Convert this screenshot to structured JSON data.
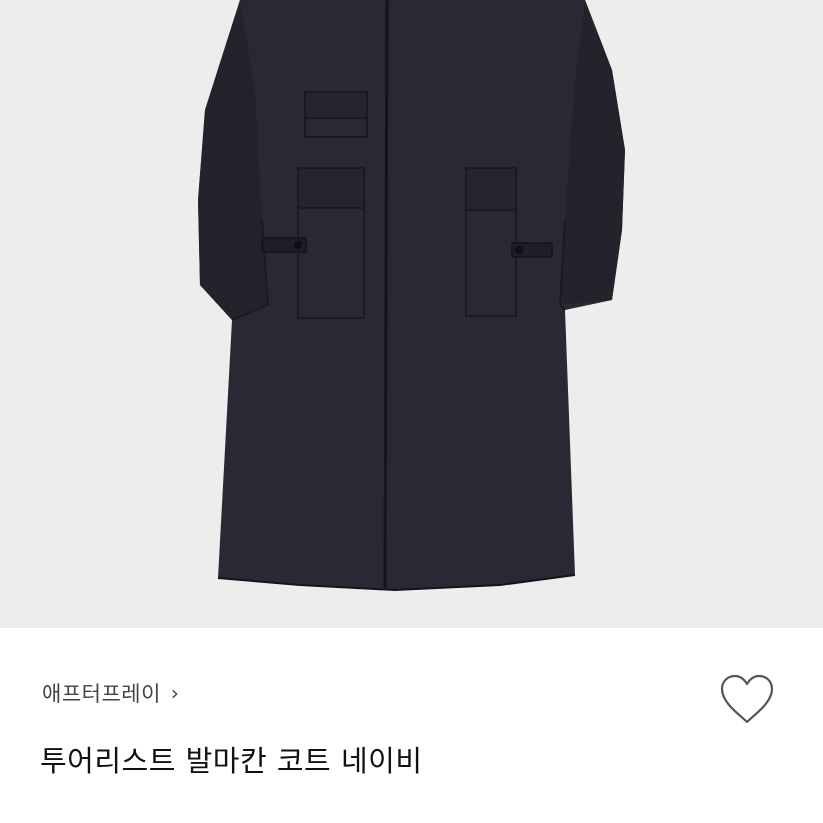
{
  "product": {
    "image_alt": "navy balmacaan coat",
    "brand": "애프터프레이",
    "brand_chevron": "›",
    "title": "투어리스트 발마칸 코트 네이비",
    "liked": false
  },
  "colors": {
    "image_background": "#ededee",
    "coat": "#2a2933",
    "coat_shadow": "#1d1c24",
    "brand_text": "#444444",
    "title_text": "#111111",
    "heart_outline": "#555555"
  },
  "icons": {
    "brand": "chevron-right-icon",
    "like": "heart-icon"
  }
}
